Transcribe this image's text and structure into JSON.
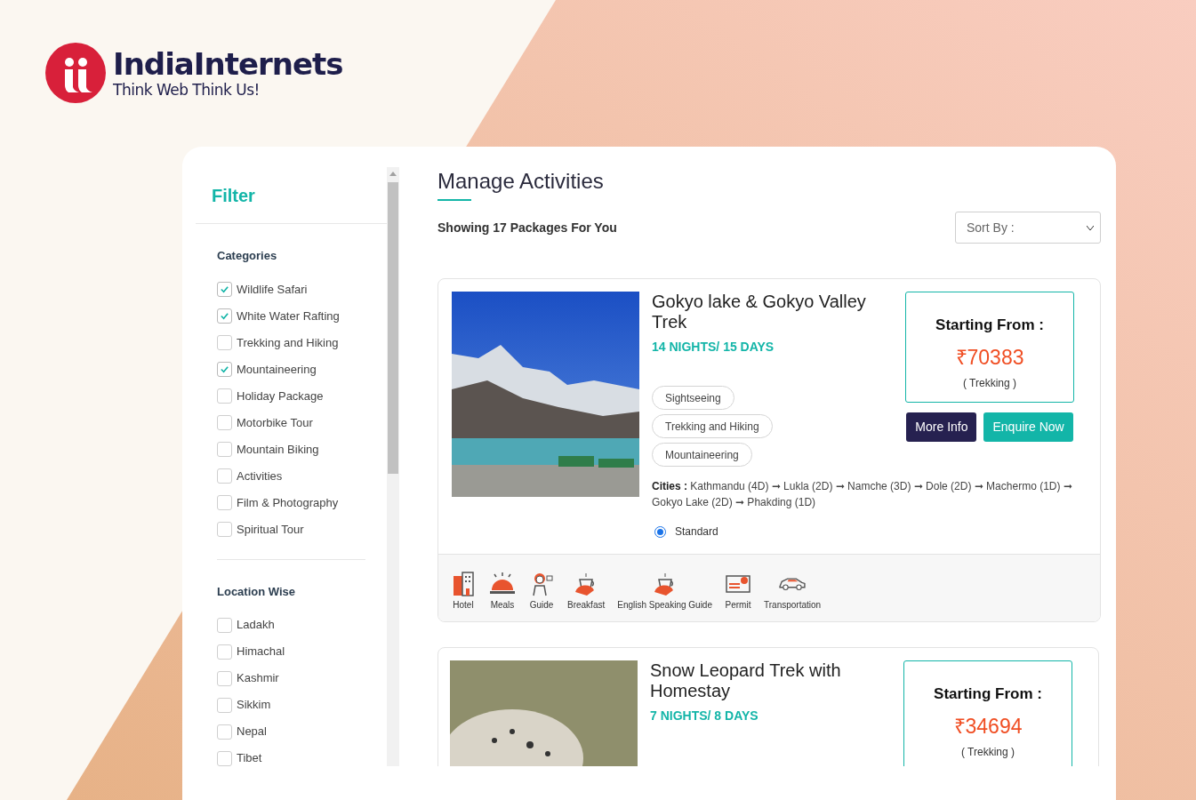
{
  "brand": {
    "name": "IndiaInternets",
    "tagline": "Think Web Think Us!"
  },
  "filter": {
    "title": "Filter",
    "groups": [
      {
        "title": "Categories",
        "options": [
          {
            "label": "Wildlife Safari",
            "checked": true
          },
          {
            "label": "White Water Rafting",
            "checked": true
          },
          {
            "label": "Trekking and Hiking",
            "checked": false
          },
          {
            "label": "Mountaineering",
            "checked": true
          },
          {
            "label": "Holiday Package",
            "checked": false
          },
          {
            "label": "Motorbike Tour",
            "checked": false
          },
          {
            "label": "Mountain Biking",
            "checked": false
          },
          {
            "label": "Activities",
            "checked": false
          },
          {
            "label": "Film & Photography",
            "checked": false
          },
          {
            "label": "Spiritual Tour",
            "checked": false
          }
        ]
      },
      {
        "title": "Location Wise",
        "options": [
          {
            "label": "Ladakh",
            "checked": false
          },
          {
            "label": "Himachal",
            "checked": false
          },
          {
            "label": "Kashmir",
            "checked": false
          },
          {
            "label": "Sikkim",
            "checked": false
          },
          {
            "label": "Nepal",
            "checked": false
          },
          {
            "label": "Tibet",
            "checked": false
          }
        ]
      }
    ]
  },
  "main": {
    "title": "Manage Activities",
    "summary": "Showing 17 Packages For You",
    "sort": {
      "placeholder": "Sort By :"
    }
  },
  "packages": [
    {
      "title": "Gokyo lake & Gokyo Valley Trek",
      "duration": "14 NIGHTS/ 15 DAYS",
      "price_label": "Starting From :",
      "price": "₹70383",
      "category": "( Trekking )",
      "tags": [
        "Sightseeing",
        "Trekking and Hiking",
        "Mountaineering"
      ],
      "buttons": [
        {
          "label": "More Info",
          "kind": "info"
        },
        {
          "label": "Enquire Now",
          "kind": "enquire"
        }
      ],
      "cities_label": "Cities :",
      "cities": "Kathmandu (4D) ➞ Lukla (2D) ➞ Namche (3D) ➞ Dole (2D) ➞ Machermo (1D) ➞ Gokyo Lake (2D) ➞ Phakding (1D)",
      "options": [
        {
          "label": "Standard",
          "selected": true
        }
      ],
      "amenities": [
        {
          "label": "Hotel",
          "kind": "hotel"
        },
        {
          "label": "Meals",
          "kind": "meals"
        },
        {
          "label": "Guide",
          "kind": "guide"
        },
        {
          "label": "Breakfast",
          "kind": "breakfast"
        },
        {
          "label": "English Speaking Guide",
          "kind": "breakfast"
        },
        {
          "label": "Permit",
          "kind": "permit"
        },
        {
          "label": "Transportation",
          "kind": "car"
        }
      ]
    },
    {
      "title": "Snow Leopard Trek with Homestay",
      "duration": "7 NIGHTS/ 8 DAYS",
      "price_label": "Starting From :",
      "price": "₹34694",
      "category": "( Trekking )"
    }
  ]
}
